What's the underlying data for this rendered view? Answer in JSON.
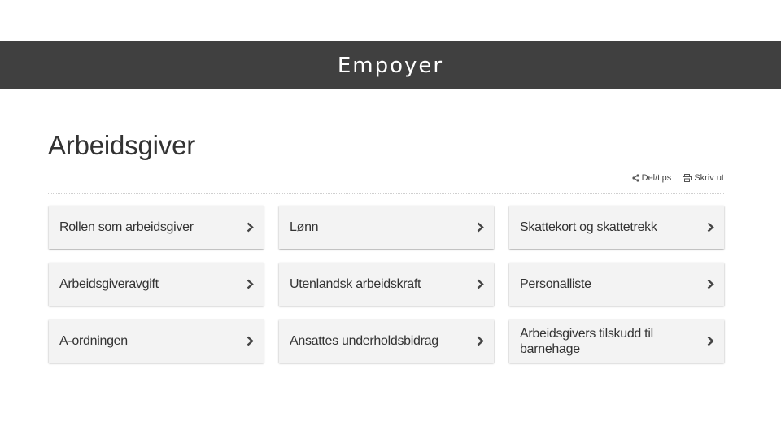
{
  "banner": {
    "title": "Empoyer"
  },
  "page": {
    "title": "Arbeidsgiver"
  },
  "actions": {
    "share_label": "Del/tips",
    "share_icon": "share-icon",
    "print_label": "Skriv ut",
    "print_icon": "printer-icon"
  },
  "cards": [
    {
      "label": "Rollen som arbeidsgiver",
      "icon": "chevron-right-icon"
    },
    {
      "label": "Lønn",
      "icon": "chevron-right-icon"
    },
    {
      "label": "Skattekort og skattetrekk",
      "icon": "chevron-right-icon"
    },
    {
      "label": "Arbeidsgiveravgift",
      "icon": "chevron-right-icon"
    },
    {
      "label": "Utenlandsk arbeidskraft",
      "icon": "chevron-right-icon"
    },
    {
      "label": "Personalliste",
      "icon": "chevron-right-icon"
    },
    {
      "label": "A-ordningen",
      "icon": "chevron-right-icon"
    },
    {
      "label": "Ansattes underholdsbidrag",
      "icon": "chevron-right-icon"
    },
    {
      "label": "Arbeidsgivers tilskudd til barnehage",
      "icon": "chevron-right-icon"
    }
  ],
  "colors": {
    "banner_background": "#404040",
    "card_background": "#f3f3f3",
    "text": "#333333"
  }
}
